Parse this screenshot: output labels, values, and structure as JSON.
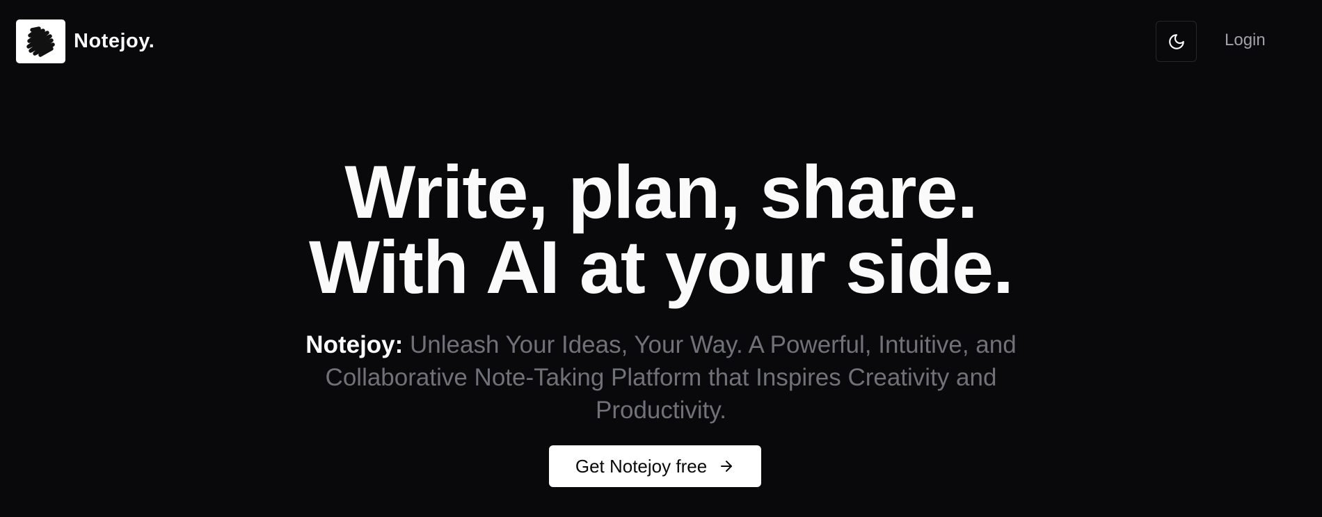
{
  "header": {
    "brand_name": "Notejoy.",
    "theme_toggle_icon": "moon-icon",
    "login_label": "Login"
  },
  "hero": {
    "headline_line1": "Write, plan, share.",
    "headline_line2": "With AI at your side.",
    "subtitle_brand": "Notejoy:",
    "subtitle_text": "Unleash Your Ideas, Your Way. A Powerful, Intuitive, and Collaborative Note-Taking Platform that Inspires Creativity and Productivity.",
    "cta_label": "Get Notejoy free",
    "cta_icon": "arrow-right-icon"
  },
  "colors": {
    "background": "#09090b",
    "text_primary": "#fafafa",
    "text_muted": "#71717a",
    "border": "#27272a",
    "cta_background": "#ffffff"
  }
}
